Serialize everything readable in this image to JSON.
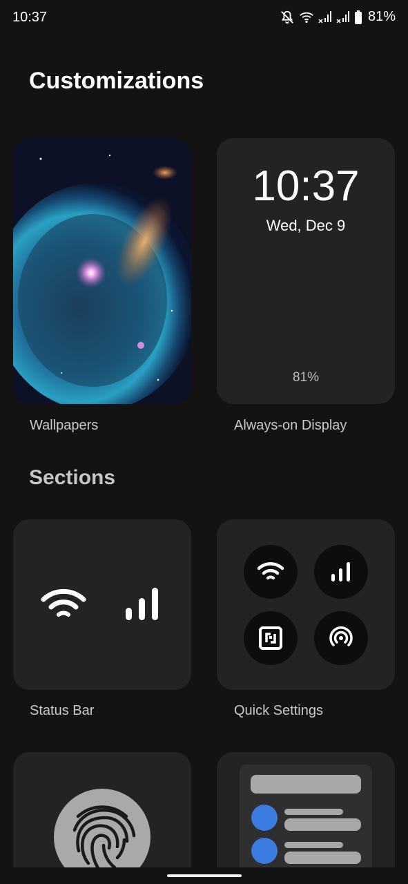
{
  "status_bar": {
    "time": "10:37",
    "battery_percent": "81%",
    "icons": [
      "notifications-off-icon",
      "wifi-icon",
      "signal-x-icon",
      "signal-x-icon",
      "battery-icon"
    ]
  },
  "page": {
    "title": "Customizations",
    "sections_heading": "Sections"
  },
  "cards": {
    "wallpapers": {
      "label": "Wallpapers"
    },
    "aod": {
      "label": "Always-on Display",
      "time": "10:37",
      "date": "Wed, Dec 9",
      "battery": "81%"
    },
    "status_bar": {
      "label": "Status Bar"
    },
    "quick_settings": {
      "label": "Quick Settings",
      "tiles": [
        "wifi-icon",
        "cellular-signal-icon",
        "nfc-icon",
        "hotspot-icon"
      ]
    },
    "lock_screen": {
      "icon": "fingerprint-icon"
    },
    "notifications": {
      "icon": "notification-preview"
    }
  },
  "colors": {
    "background": "#131313",
    "card": "#232323",
    "accent": "#3c7be0"
  }
}
